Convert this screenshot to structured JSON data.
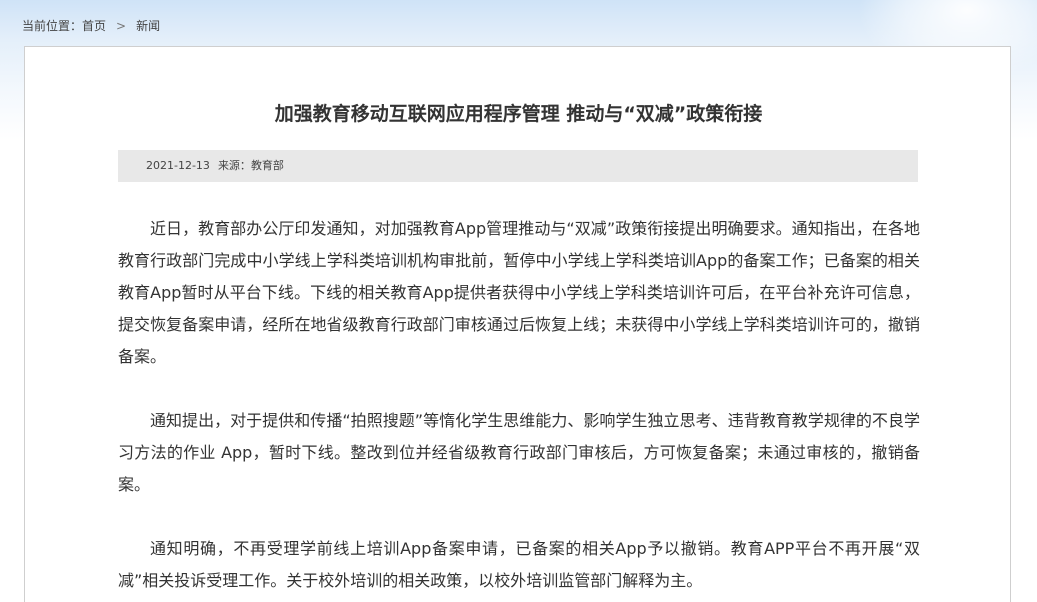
{
  "breadcrumb": {
    "prefix": "当前位置：",
    "home": "首页",
    "separator": ">",
    "current": "新闻"
  },
  "article": {
    "title": "加强教育移动互联网应用程序管理 推动与“双减”政策衔接",
    "date": "2021-12-13",
    "source_label": "来源：",
    "source": "教育部",
    "paragraphs": [
      "近日，教育部办公厅印发通知，对加强教育App管理推动与“双减”政策衔接提出明确要求。通知指出，在各地教育行政部门完成中小学线上学科类培训机构审批前，暂停中小学线上学科类培训App的备案工作；已备案的相关教育App暂时从平台下线。下线的相关教育App提供者获得中小学线上学科类培训许可后，在平台补充许可信息，提交恢复备案申请，经所在地省级教育行政部门审核通过后恢复上线；未获得中小学线上学科类培训许可的，撤销备案。",
      "通知提出，对于提供和传播“拍照搜题”等惰化学生思维能力、影响学生独立思考、违背教育教学规律的不良学习方法的作业 App，暂时下线。整改到位并经省级教育行政部门审核后，方可恢复备案；未通过审核的，撤销备案。",
      "通知明确，不再受理学前线上培训App备案申请，已备案的相关App予以撤销。教育APP平台不再开展“双减”相关投诉受理工作。关于校外培训的相关政策，以校外培训监管部门解释为主。"
    ]
  }
}
